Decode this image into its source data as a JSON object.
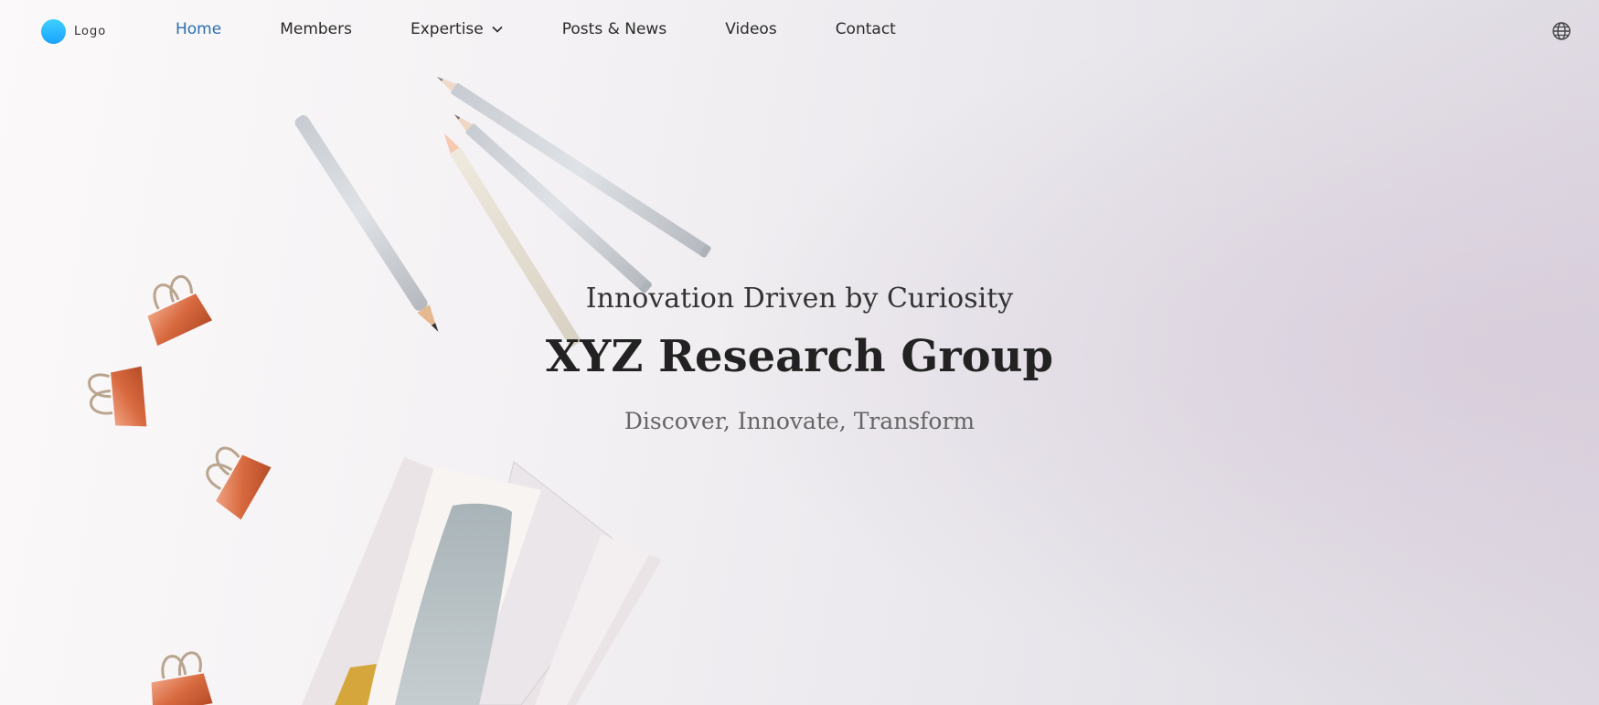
{
  "logo": {
    "label": "Logo"
  },
  "nav": {
    "items": [
      {
        "label": "Home",
        "active": true
      },
      {
        "label": "Members"
      },
      {
        "label": "Expertise",
        "has_dropdown": true
      },
      {
        "label": "Posts & News"
      },
      {
        "label": "Videos"
      },
      {
        "label": "Contact"
      }
    ],
    "language_icon": "globe-icon"
  },
  "hero": {
    "tagline": "Innovation Driven by Curiosity",
    "title": "XYZ Research Group",
    "subtitle": "Discover, Innovate, Transform"
  },
  "colors": {
    "accent": "#2a6fb0",
    "logo_gradient_top": "#3fd0ff",
    "logo_gradient_bottom": "#1aa3ff",
    "text_dark": "#222222",
    "text_muted": "#666666"
  }
}
